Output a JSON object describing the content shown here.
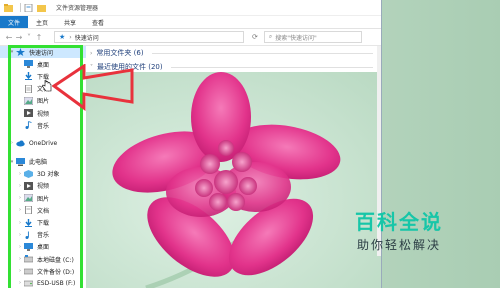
{
  "window": {
    "title": "文件资源管理器",
    "ribbon_tabs": [
      "文件",
      "主页",
      "共享",
      "查看"
    ]
  },
  "address": {
    "path": "快速访问",
    "search_placeholder": "搜索\"快速访问\""
  },
  "nav": {
    "quick_access": "快速访问",
    "quick_items": [
      {
        "label": "桌面",
        "icon": "desktop-icon"
      },
      {
        "label": "下载",
        "icon": "download-icon"
      },
      {
        "label": "文档",
        "icon": "document-icon"
      },
      {
        "label": "图片",
        "icon": "picture-icon"
      },
      {
        "label": "视频",
        "icon": "video-icon"
      },
      {
        "label": "音乐",
        "icon": "music-icon"
      }
    ],
    "onedrive": "OneDrive",
    "this_pc": "此电脑",
    "pc_items": [
      {
        "label": "3D 对象",
        "icon": "3d-objects-icon"
      },
      {
        "label": "视频",
        "icon": "video-icon"
      },
      {
        "label": "图片",
        "icon": "picture-icon"
      },
      {
        "label": "文档",
        "icon": "document-icon"
      },
      {
        "label": "下载",
        "icon": "download-icon"
      },
      {
        "label": "音乐",
        "icon": "music-icon"
      },
      {
        "label": "桌面",
        "icon": "desktop-icon"
      },
      {
        "label": "本地磁盘 (C:)",
        "icon": "drive-icon"
      },
      {
        "label": "文件备份 (D:)",
        "icon": "drive-icon"
      },
      {
        "label": "ESD-USB (F:)",
        "icon": "usb-drive-icon"
      }
    ]
  },
  "content": {
    "frequent_folders": "常用文件夹 (6)",
    "recent_files": "最近使用的文件 (20)"
  },
  "watermark": {
    "title": "百科全说",
    "subtitle": "助你轻松解决"
  },
  "colors": {
    "accent": "#1979ca",
    "highlight": "#33e033",
    "arrow": "#e8323c",
    "watermark": "#17c6a8"
  }
}
